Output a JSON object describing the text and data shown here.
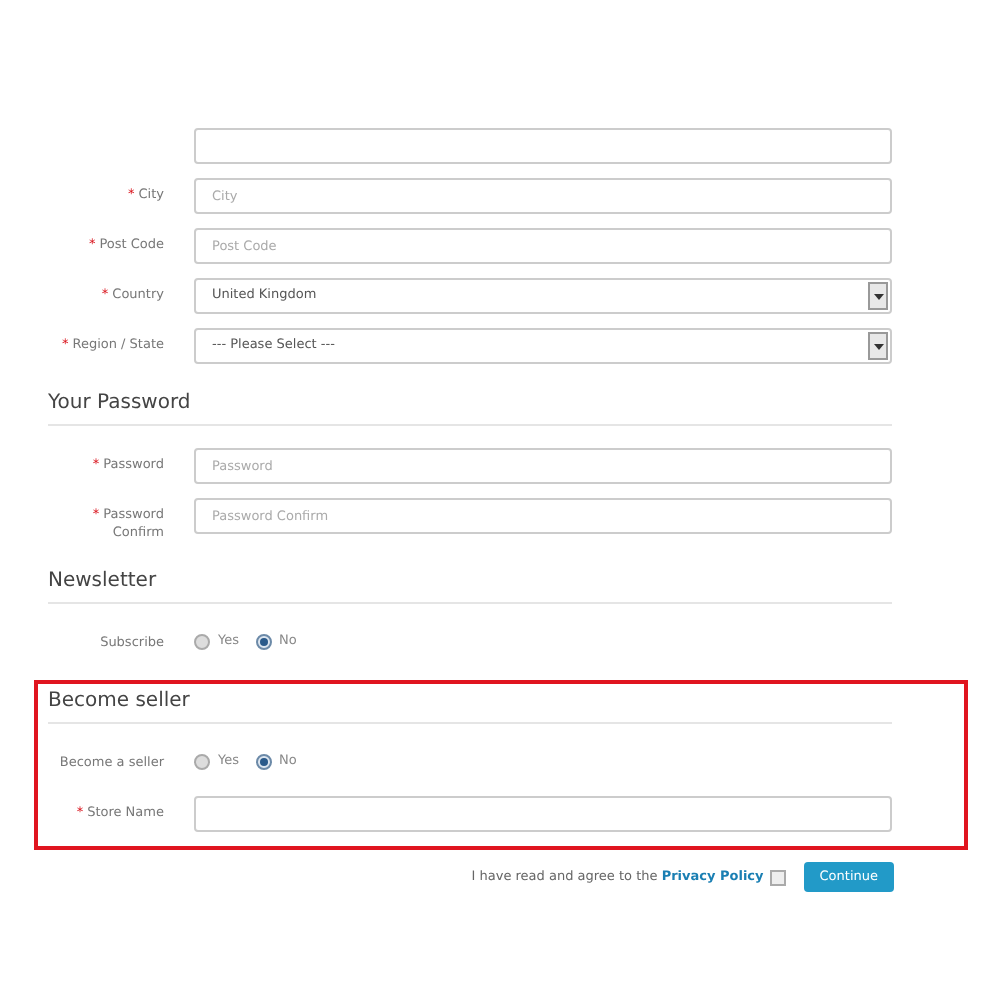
{
  "sections": [
    {
      "highlighted": false,
      "fields": [
        {
          "kind": "input"
        },
        {
          "kind": "input",
          "label": "City",
          "required_mark": "*",
          "placeholder": "City"
        },
        {
          "kind": "input",
          "label": "Post Code",
          "required_mark": "*",
          "placeholder": "Post Code"
        },
        {
          "kind": "select",
          "label": "Country",
          "required_mark": "*",
          "value": "United Kingdom"
        },
        {
          "kind": "select",
          "label": "Region / State",
          "required_mark": "*",
          "value": "--- Please Select ---"
        }
      ]
    },
    {
      "heading": "Your Password",
      "highlighted": false,
      "fields": [
        {
          "kind": "input",
          "label": "Password",
          "required_mark": "*",
          "placeholder": "Password"
        },
        {
          "kind": "input",
          "label": "Password Confirm",
          "required_mark": "*",
          "placeholder": "Password Confirm"
        }
      ]
    },
    {
      "heading": "Newsletter",
      "highlighted": false,
      "fields": [
        {
          "kind": "radio",
          "label": "Subscribe",
          "options": [
            {
              "label": "Yes",
              "selected": false
            },
            {
              "label": "No",
              "selected": true
            }
          ]
        }
      ]
    },
    {
      "heading": "Become seller",
      "highlighted": true,
      "fields": [
        {
          "kind": "radio",
          "label": "Become a seller",
          "options": [
            {
              "label": "Yes",
              "selected": false
            },
            {
              "label": "No",
              "selected": true
            }
          ]
        },
        {
          "kind": "input",
          "label": "Store Name",
          "required_mark": "*"
        }
      ]
    }
  ],
  "agreement": {
    "text": "I have read and agree to the",
    "link": "Privacy Policy",
    "checked": false
  },
  "submit": "Continue"
}
